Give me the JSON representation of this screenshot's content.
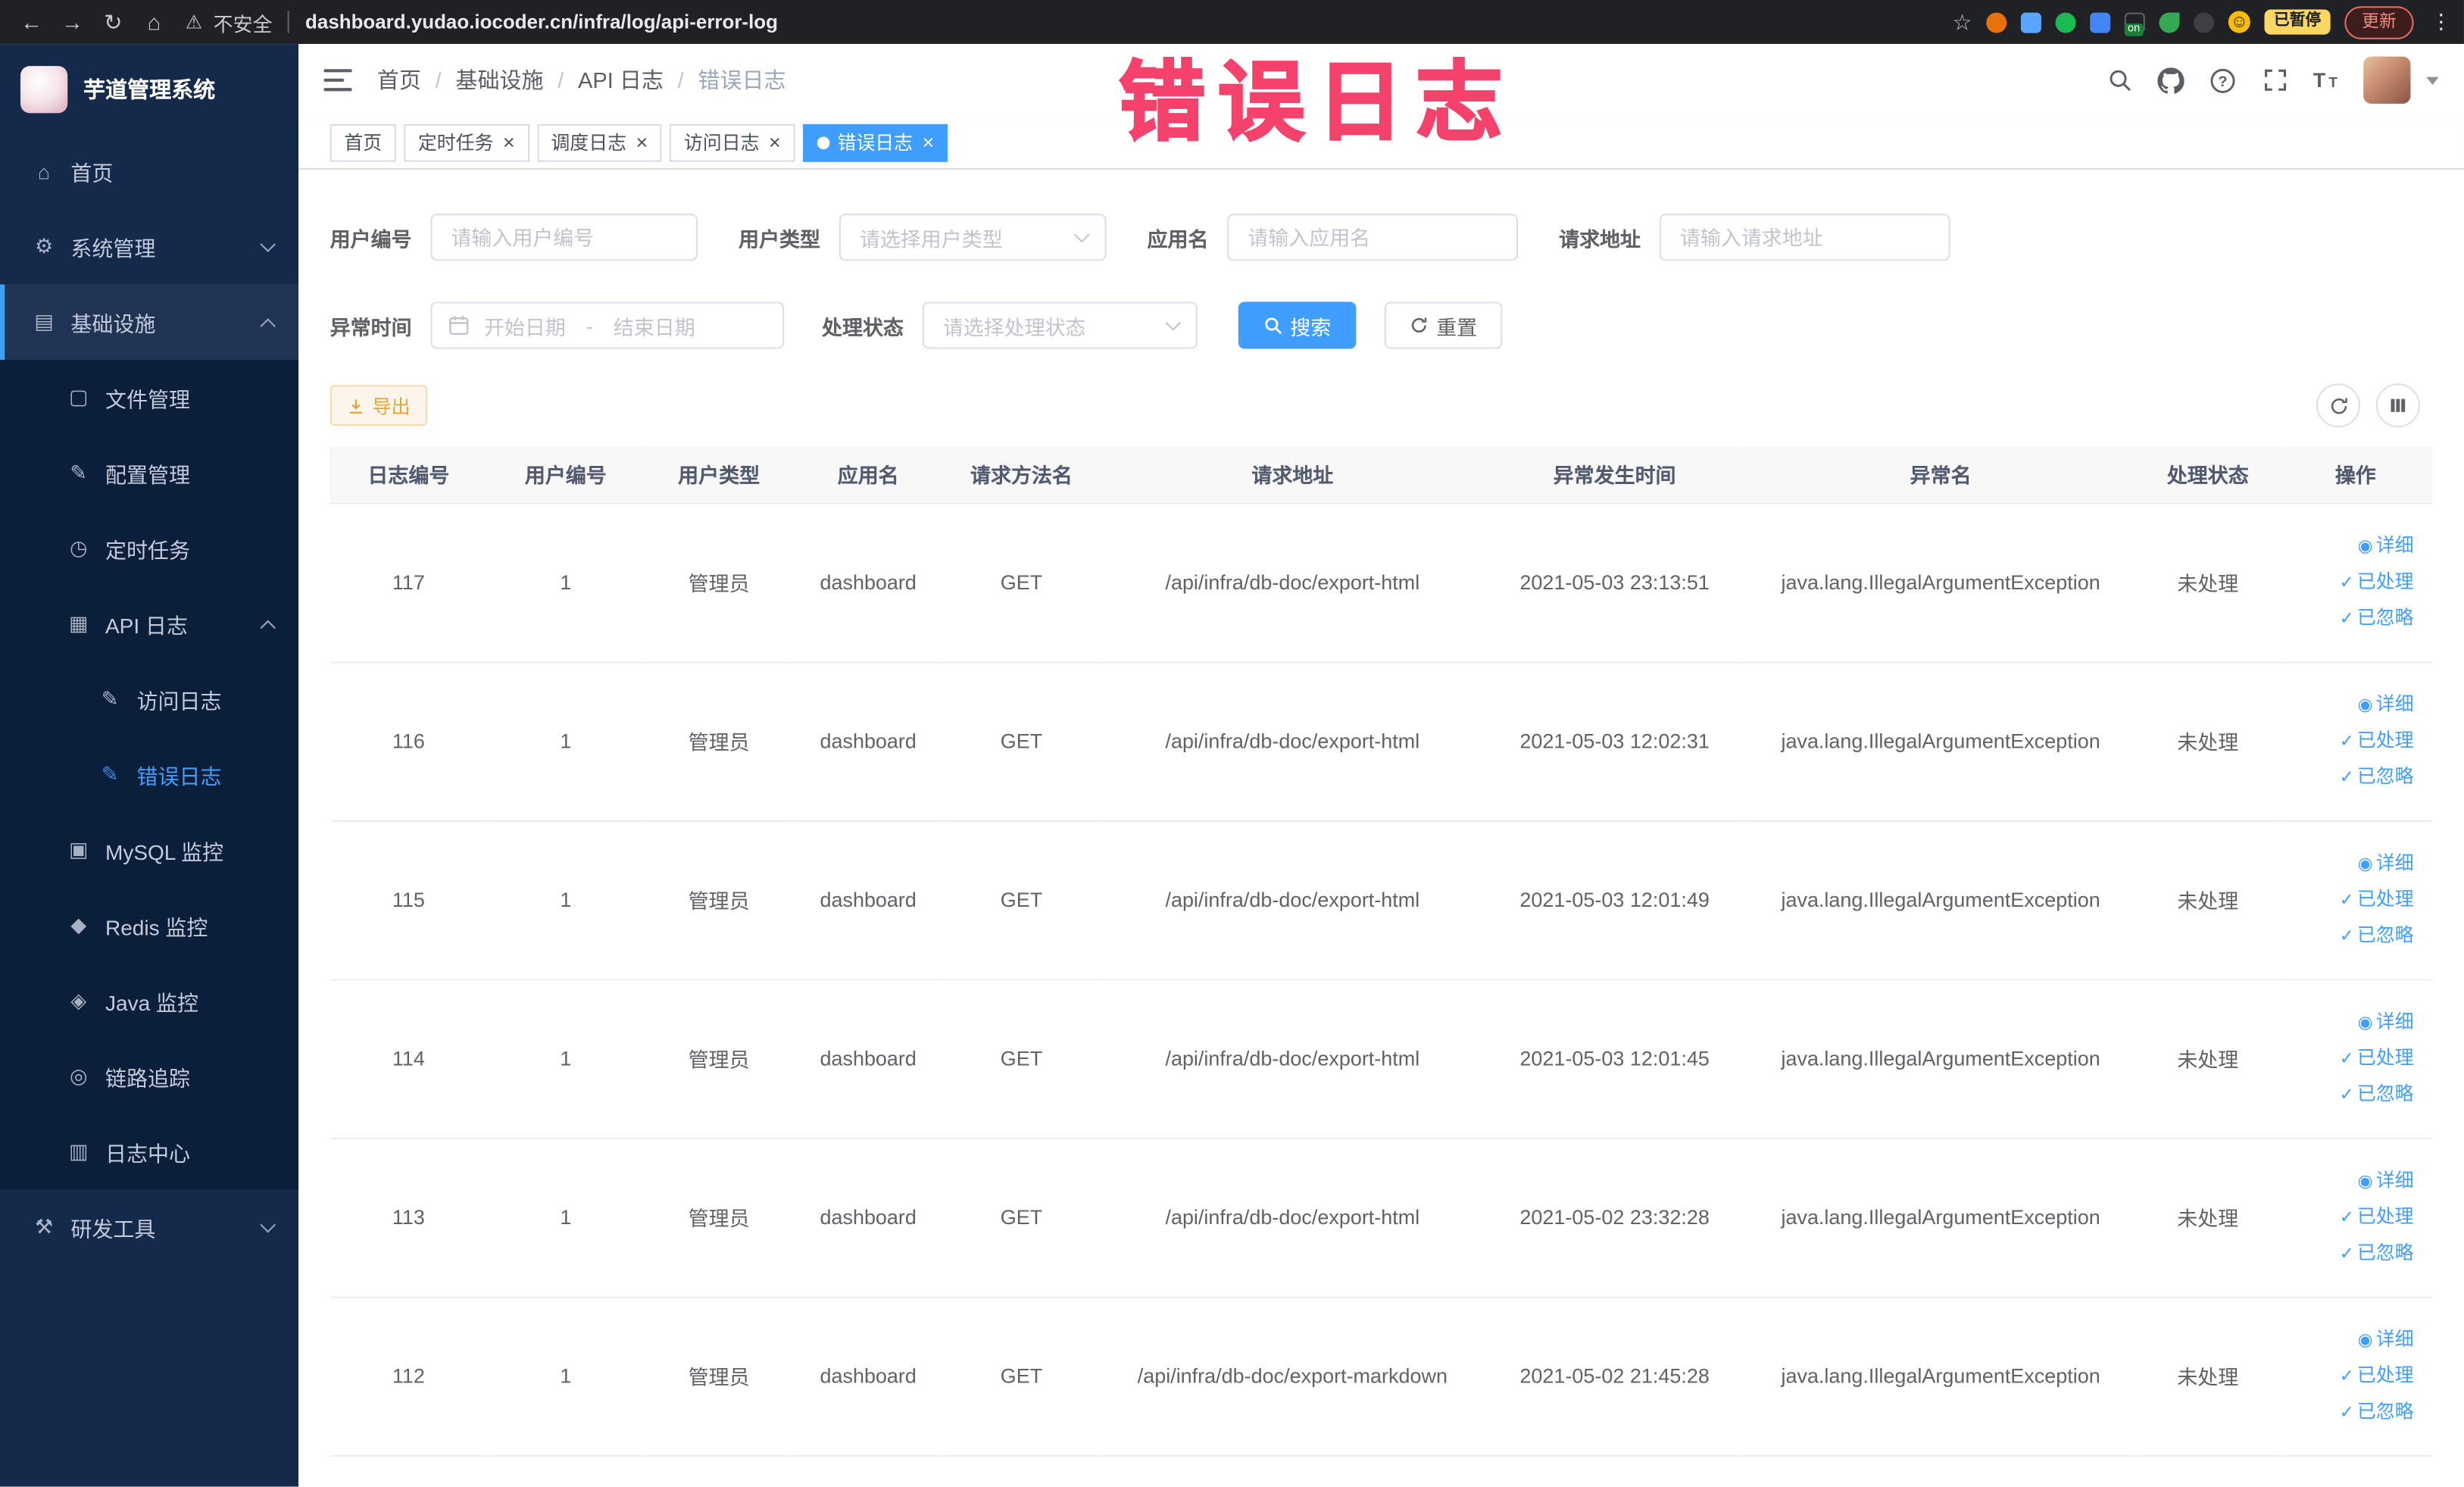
{
  "browser": {
    "security_label": "不安全",
    "url": "dashboard.yudao.iocoder.cn/infra/log/api-error-log",
    "ext_on_badge": "on",
    "paused_badge": "已暂停",
    "update_label": "更新"
  },
  "annotation": {
    "text": "错误日志"
  },
  "sidebar": {
    "logo_title": "芋道管理系统",
    "items": [
      {
        "label": "首页",
        "level": 0,
        "icon": "home"
      },
      {
        "label": "系统管理",
        "level": 0,
        "icon": "system",
        "arrow": "down"
      },
      {
        "label": "基础设施",
        "level": 0,
        "icon": "infra",
        "arrow": "up",
        "selected": true
      },
      {
        "label": "文件管理",
        "level": 1,
        "icon": "file",
        "sub": true
      },
      {
        "label": "配置管理",
        "level": 1,
        "icon": "config",
        "sub": true
      },
      {
        "label": "定时任务",
        "level": 1,
        "icon": "timer",
        "sub": true
      },
      {
        "label": "API 日志",
        "level": 1,
        "icon": "api-log",
        "sub": true,
        "arrow": "up"
      },
      {
        "label": "访问日志",
        "level": 2,
        "icon": "doc",
        "sub": true
      },
      {
        "label": "错误日志",
        "level": 2,
        "icon": "doc",
        "sub": true,
        "active": true
      },
      {
        "label": "MySQL 监控",
        "level": 1,
        "icon": "mysql",
        "sub": true
      },
      {
        "label": "Redis 监控",
        "level": 1,
        "icon": "redis",
        "sub": true
      },
      {
        "label": "Java 监控",
        "level": 1,
        "icon": "java",
        "sub": true
      },
      {
        "label": "链路追踪",
        "level": 1,
        "icon": "trace",
        "sub": true
      },
      {
        "label": "日志中心",
        "level": 1,
        "icon": "log-center",
        "sub": true
      },
      {
        "label": "研发工具",
        "level": 0,
        "icon": "tools",
        "arrow": "down"
      }
    ]
  },
  "header": {
    "breadcrumb": [
      "首页",
      "基础设施",
      "API 日志",
      "错误日志"
    ],
    "separator": "/"
  },
  "tabs": [
    {
      "label": "首页",
      "closable": false,
      "active": false
    },
    {
      "label": "定时任务",
      "closable": true,
      "active": false
    },
    {
      "label": "调度日志",
      "closable": true,
      "active": false
    },
    {
      "label": "访问日志",
      "closable": true,
      "active": false
    },
    {
      "label": "错误日志",
      "closable": true,
      "active": true
    }
  ],
  "filters": {
    "user_id": {
      "label": "用户编号",
      "placeholder": "请输入用户编号"
    },
    "user_type": {
      "label": "用户类型",
      "placeholder": "请选择用户类型"
    },
    "app_name": {
      "label": "应用名",
      "placeholder": "请输入应用名"
    },
    "request_url": {
      "label": "请求地址",
      "placeholder": "请输入请求地址"
    },
    "exception_time": {
      "label": "异常时间",
      "start_placeholder": "开始日期",
      "separator": "-",
      "end_placeholder": "结束日期"
    },
    "process_status": {
      "label": "处理状态",
      "placeholder": "请选择处理状态"
    },
    "search_label": "搜索",
    "reset_label": "重置"
  },
  "toolbar": {
    "export_label": "导出"
  },
  "table": {
    "columns": [
      "日志编号",
      "用户编号",
      "用户类型",
      "应用名",
      "请求方法名",
      "请求地址",
      "异常发生时间",
      "异常名",
      "处理状态",
      "操作"
    ],
    "rows": [
      {
        "id": "117",
        "user_id": "1",
        "user_type": "管理员",
        "app": "dashboard",
        "method": "GET",
        "url": "/api/infra/db-doc/export-html",
        "time": "2021-05-03 23:13:51",
        "exception": "java.lang.IllegalArgumentException",
        "status": "未处理"
      },
      {
        "id": "116",
        "user_id": "1",
        "user_type": "管理员",
        "app": "dashboard",
        "method": "GET",
        "url": "/api/infra/db-doc/export-html",
        "time": "2021-05-03 12:02:31",
        "exception": "java.lang.IllegalArgumentException",
        "status": "未处理"
      },
      {
        "id": "115",
        "user_id": "1",
        "user_type": "管理员",
        "app": "dashboard",
        "method": "GET",
        "url": "/api/infra/db-doc/export-html",
        "time": "2021-05-03 12:01:49",
        "exception": "java.lang.IllegalArgumentException",
        "status": "未处理"
      },
      {
        "id": "114",
        "user_id": "1",
        "user_type": "管理员",
        "app": "dashboard",
        "method": "GET",
        "url": "/api/infra/db-doc/export-html",
        "time": "2021-05-03 12:01:45",
        "exception": "java.lang.IllegalArgumentException",
        "status": "未处理"
      },
      {
        "id": "113",
        "user_id": "1",
        "user_type": "管理员",
        "app": "dashboard",
        "method": "GET",
        "url": "/api/infra/db-doc/export-html",
        "time": "2021-05-02 23:32:28",
        "exception": "java.lang.IllegalArgumentException",
        "status": "未处理"
      },
      {
        "id": "112",
        "user_id": "1",
        "user_type": "管理员",
        "app": "dashboard",
        "method": "GET",
        "url": "/api/infra/db-doc/export-markdown",
        "time": "2021-05-02 21:45:28",
        "exception": "java.lang.IllegalArgumentException",
        "status": "未处理"
      }
    ]
  },
  "row_actions": {
    "detail": "详细",
    "processed": "已处理",
    "ignored": "已忽略"
  },
  "colors": {
    "primary": "#409eff",
    "warning": "#e6a23c",
    "annotation": "#f4426c",
    "sidebar_bg": "#15294a"
  }
}
